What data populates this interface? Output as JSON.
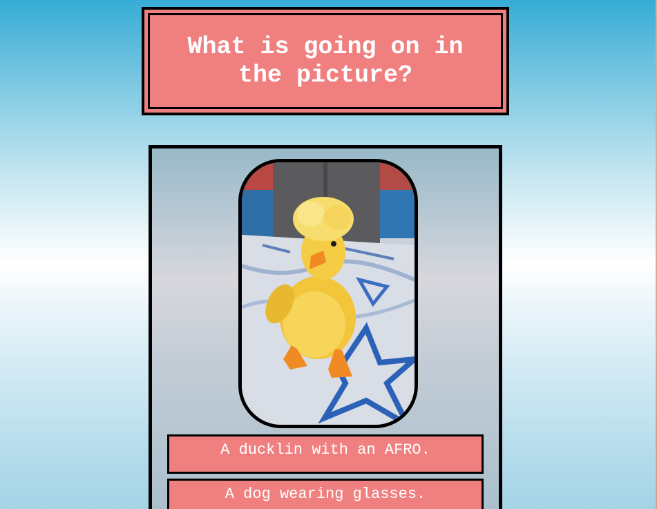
{
  "quiz": {
    "question": "What is going on in the picture?",
    "image_subject": "yellow duckling with fluffy crest standing on a blue-patterned rug",
    "answers": [
      {
        "label": "A ducklin with an AFRO."
      },
      {
        "label": "A dog wearing glasses."
      }
    ]
  },
  "colors": {
    "accent": "#f08080",
    "border": "#000000",
    "text": "#ffffff",
    "sky_top": "#36acd6",
    "sky_mid": "#ffffff"
  }
}
